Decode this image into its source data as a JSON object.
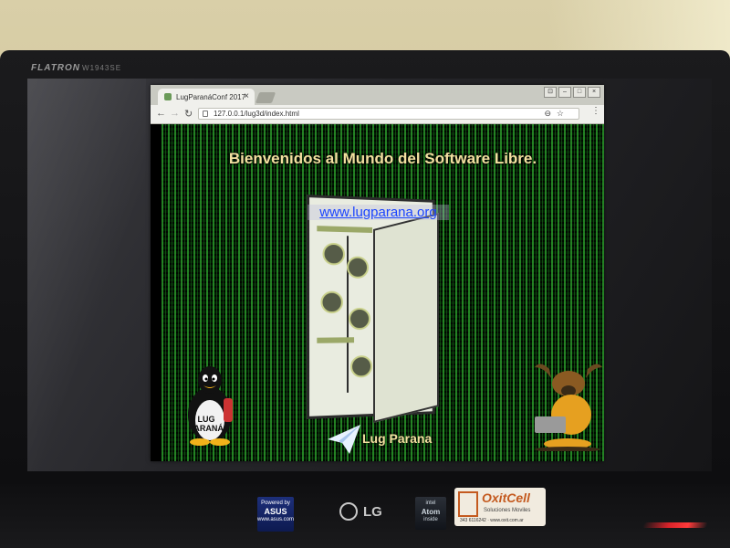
{
  "monitor": {
    "brand": "FLATRON",
    "model": "W1943SE"
  },
  "browser": {
    "tab_title": "LugParanáConf 2017",
    "url": "127.0.0.1/lug3d/index.html",
    "icons": [
      "back-icon",
      "forward-icon",
      "reload-icon",
      "zoom-icon",
      "star-icon",
      "menu-icon",
      "close-icon"
    ]
  },
  "webpage": {
    "title": "Bienvenidos al Mundo del Software Libre.",
    "link": "www.lugparana.org",
    "tux_label_line1": "LUG",
    "tux_label_line2": "PARANÁ",
    "footer_text": "Lug Parana"
  },
  "stickers": {
    "asus_top": "Powered by",
    "asus_name": "ASUS",
    "asus_url": "www.asus.com",
    "lg": "LG",
    "intel": "intel",
    "atom": "Atom",
    "atom_sub": "inside",
    "oxit_name": "OxitCell",
    "oxit_sub": "Soluciones Moviles",
    "oxit_contact": "343 6116242 · www.oxit.com.ar"
  },
  "colors": {
    "matrix_green": "#40dc40",
    "title_color": "#f3e1a0",
    "link_color": "#1a44ff",
    "power_led": "#d8232a"
  }
}
